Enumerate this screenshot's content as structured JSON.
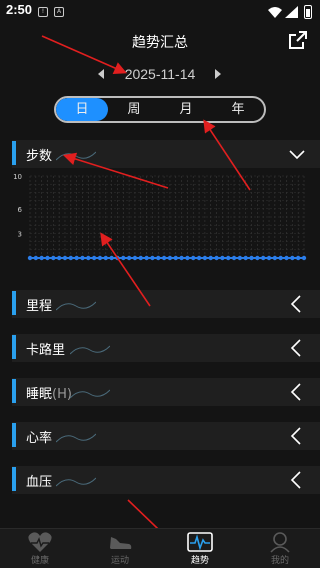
{
  "status": {
    "time": "2:50",
    "notif_a": "!",
    "notif_b": "A"
  },
  "header": {
    "title": "趋势汇总"
  },
  "date": "2025-11-14",
  "tabs": [
    "日",
    "周",
    "月",
    "年"
  ],
  "sections": [
    {
      "label": "步数",
      "unit": ""
    },
    {
      "label": "里程",
      "unit": ""
    },
    {
      "label": "卡路里",
      "unit": ""
    },
    {
      "label": "睡眠",
      "unit": "(H)"
    },
    {
      "label": "心率",
      "unit": ""
    },
    {
      "label": "血压",
      "unit": ""
    }
  ],
  "chart_data": {
    "type": "line",
    "series": [
      {
        "values": [
          0,
          0,
          0,
          0,
          0,
          0,
          0,
          0,
          0,
          0,
          0,
          0,
          0,
          0,
          0,
          0,
          0,
          0,
          0,
          0,
          0,
          0,
          0,
          0,
          0,
          0,
          0,
          0,
          0,
          0,
          0,
          0,
          0,
          0,
          0,
          0,
          0,
          0,
          0,
          0,
          0,
          0,
          0,
          0,
          0,
          0,
          0,
          0
        ]
      }
    ],
    "yticks": [
      "10",
      "6",
      "3"
    ],
    "ylim": [
      0,
      10
    ],
    "grid": true
  },
  "nav": [
    {
      "label": "健康",
      "icon": "heart-icon"
    },
    {
      "label": "运动",
      "icon": "shoe-icon"
    },
    {
      "label": "趋势",
      "icon": "pulse-icon"
    },
    {
      "label": "我的",
      "icon": "person-icon"
    }
  ],
  "colors": {
    "accent": "#1e90ff",
    "section_bar": "#2aa0ee",
    "annotation": "#e11f1f",
    "line": "#2b7de9"
  }
}
